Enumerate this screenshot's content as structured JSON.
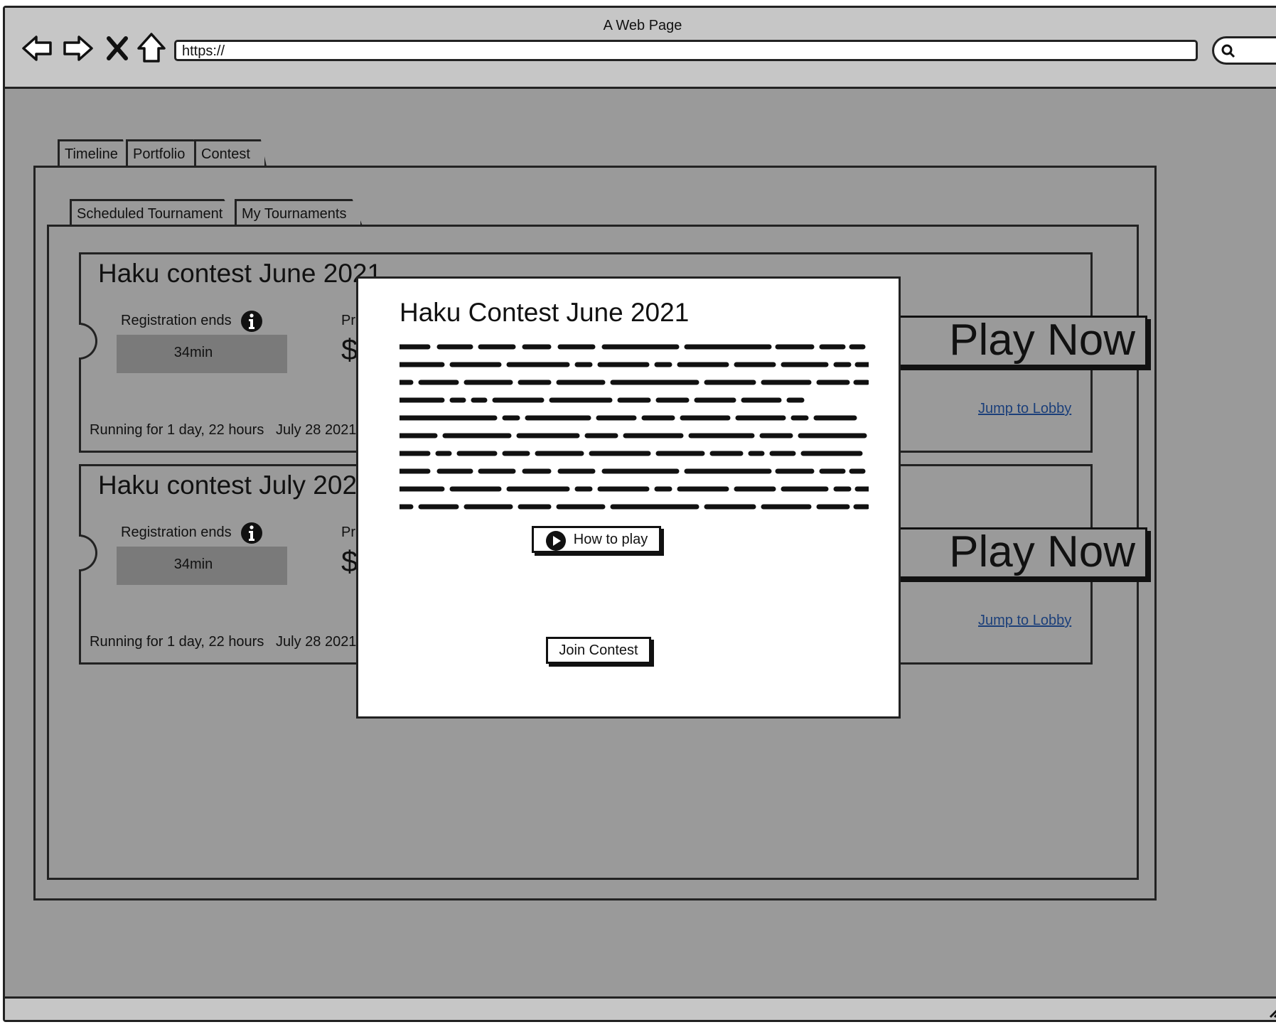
{
  "window": {
    "title": "A Web Page",
    "url": "https://"
  },
  "nav": {
    "back_icon": "back-arrow-icon",
    "forward_icon": "forward-arrow-icon",
    "stop_icon": "close-icon",
    "home_icon": "home-icon",
    "search_icon": "search-icon"
  },
  "main_tabs": [
    {
      "label": "Timeline"
    },
    {
      "label": "Portfolio"
    },
    {
      "label": "Contest"
    }
  ],
  "sub_tabs": [
    {
      "label": "Scheduled Tournament"
    },
    {
      "label": "My Tournaments"
    }
  ],
  "cards": [
    {
      "title": "Haku contest June 2021",
      "registration_label": "Registration ends",
      "registration_time": "34min",
      "prize_label": "Pri",
      "prize_value": "$",
      "running": "Running for 1 day, 22 hours",
      "date": "July 28 2021",
      "play_label": "Play Now",
      "lobby_link": "Jump to Lobby"
    },
    {
      "title": "Haku contest July 2021",
      "registration_label": "Registration ends",
      "registration_time": "34min",
      "prize_label": "Pri",
      "prize_value": "$",
      "running": "Running for 1 day, 22 hours",
      "date": "July 28 2021",
      "play_label": "Play Now",
      "lobby_link": "Jump to Lobby"
    }
  ],
  "modal": {
    "title": "Haku Contest June 2021",
    "how_to_play_label": "How to play",
    "join_label": "Join Contest"
  },
  "colors": {
    "background": "#9a9a9a",
    "chrome": "#c6c6c6",
    "modal": "#ffffff",
    "link": "#1b3f7a"
  }
}
